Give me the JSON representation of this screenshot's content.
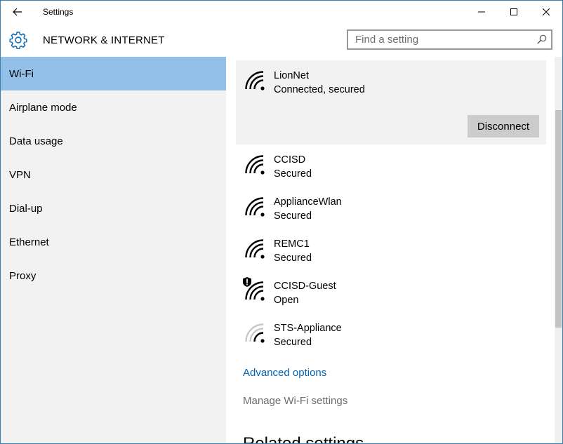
{
  "window": {
    "title": "Settings"
  },
  "header": {
    "section_title": "NETWORK & INTERNET",
    "search_placeholder": "Find a setting"
  },
  "sidebar": {
    "items": [
      {
        "label": "Wi-Fi",
        "active": true
      },
      {
        "label": "Airplane mode"
      },
      {
        "label": "Data usage"
      },
      {
        "label": "VPN"
      },
      {
        "label": "Dial-up"
      },
      {
        "label": "Ethernet"
      },
      {
        "label": "Proxy"
      }
    ]
  },
  "networks": {
    "connected": {
      "name": "LionNet",
      "status": "Connected, secured",
      "disconnect_label": "Disconnect",
      "signal_bars": 4
    },
    "list": [
      {
        "name": "CCISD",
        "status": "Secured",
        "signal_bars": 4
      },
      {
        "name": "ApplianceWlan",
        "status": "Secured",
        "signal_bars": 4
      },
      {
        "name": "REMC1",
        "status": "Secured",
        "signal_bars": 4
      },
      {
        "name": "CCISD-Guest",
        "status": "Open",
        "signal_bars": 4,
        "warning_icon": "shield-warning-icon"
      },
      {
        "name": "STS-Appliance",
        "status": "Secured",
        "signal_bars": 2
      }
    ]
  },
  "links": {
    "advanced": "Advanced options",
    "manage": "Manage Wi-Fi settings"
  },
  "related": {
    "heading": "Related settings"
  },
  "colors": {
    "accent": "#0063b1",
    "selected": "#92c0e8",
    "sidebar_bg": "#f2f2f2"
  }
}
